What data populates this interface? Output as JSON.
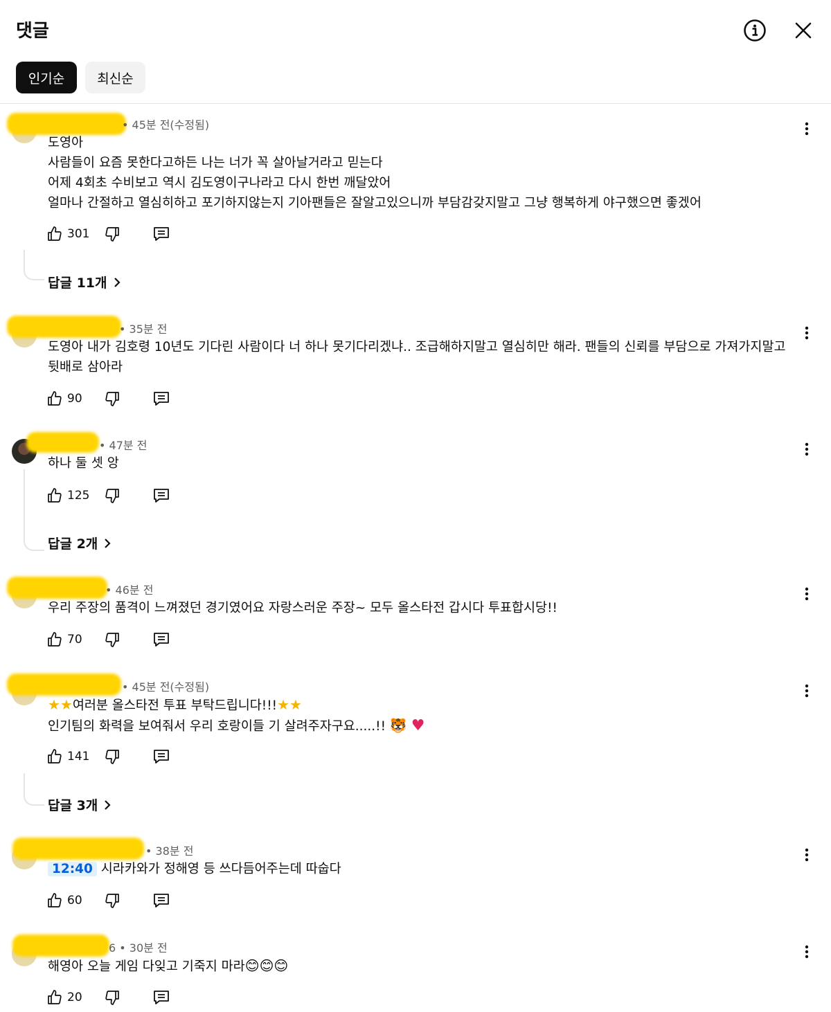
{
  "header": {
    "title": "댓글",
    "info_icon": "info-icon",
    "close_icon": "close-icon"
  },
  "sort_chips": {
    "popular": "인기순",
    "newest": "최신순",
    "selected": "인기순"
  },
  "comments": [
    {
      "meta": "45분 전(수정됨)",
      "lines": [
        "도영아",
        "사람들이 요즘 못한다고하든 나는 너가 꼭 살아날거라고 믿는다",
        "어제 4회초 수비보고 역시 김도영이구나라고 다시 한번 깨달았어",
        "얼마나 간절하고 열심히하고 포기하지않는지 기아팬들은 잘알고있으니까 부담감갖지말고 그냥 행복하게 야구했으면 좋겠어"
      ],
      "likes": "301",
      "replies": "답글 11개"
    },
    {
      "meta": "35분 전",
      "lines": [
        "도영아 내가 김호령 10년도 기다린 사람이다 너 하나 못기다리겠냐.. 조급해하지말고 열심히만 해라. 팬들의 신뢰를 부담으로 가져가지말고",
        "뒷배로 삼아라"
      ],
      "likes": "90"
    },
    {
      "meta": "47분 전",
      "lines": [
        "하나 둘 셋 앙"
      ],
      "likes": "125",
      "replies": "답글 2개"
    },
    {
      "meta": "46분 전",
      "lines": [
        "우리 주장의 품격이 느껴졌던 경기였어요 자랑스러운 주장~ 모두 올스타전 갑시다 투표합시당!!"
      ],
      "likes": "70"
    },
    {
      "meta": "45분 전(수정됨)",
      "line1_text": "여러분 올스타전 투표 부탁드립니다!!!",
      "line2_text": "인기팀의 화력을 보여줘서 우리 호랑이들 기 살려주자구요.....!!",
      "likes": "141",
      "replies": "답글 3개"
    },
    {
      "meta": "38분 전",
      "timestamp": "12:40",
      "text": "시라카와가 정해영 등 쓰다듬어주는데 따숩다",
      "likes": "60"
    },
    {
      "meta": "6 • 30분 전",
      "text": "해영아 오늘 게임 다잊고 기죽지 마라",
      "likes": "20"
    }
  ],
  "icons": {
    "like": "thumbs-up-icon",
    "dislike": "thumbs-down-icon",
    "reply": "reply-comment-icon",
    "menu": "more-vert-icon",
    "chevron": "chevron-right-icon"
  },
  "colors": {
    "redaction": "#ffd400",
    "timestamp_bg": "#def1ff",
    "timestamp_fg": "#065fd4"
  }
}
